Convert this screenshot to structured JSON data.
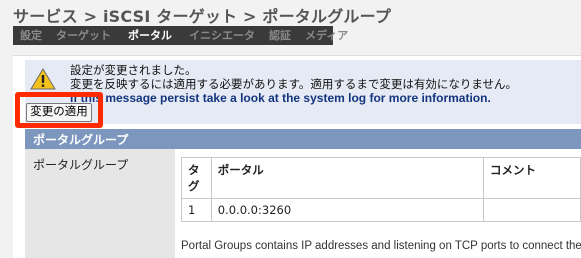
{
  "breadcrumb": "サービス > iSCSI ターゲット > ポータルグループ",
  "tabs": [
    "設定",
    "ターゲット",
    "ポータル",
    "イニシエータ",
    "認証",
    "メディア"
  ],
  "active_tab": "ポータル",
  "notice": {
    "line1": "設定が変更されました。",
    "line2": "変更を反映するには適用する必要があります。適用するまで変更は有効になりません。",
    "line3": "If this message persist take a look at the system log for more information."
  },
  "apply_button": "変更の適用",
  "section_title": "ポータルグループ",
  "field_label": "ポータルグループ",
  "table": {
    "headers": [
      "タグ",
      "ポータル",
      "コメント"
    ],
    "rows": [
      [
        "1",
        "0.0.0.0:3260",
        ""
      ]
    ]
  },
  "help_text": "Portal Groups contains IP addresses and listening on TCP ports to connect the targ",
  "colors": {
    "highlight": "#ff2a00",
    "section_header": "#7c96bd",
    "notice_bg": "#e5eaf4"
  },
  "icons": {
    "notice": "warning-icon"
  }
}
